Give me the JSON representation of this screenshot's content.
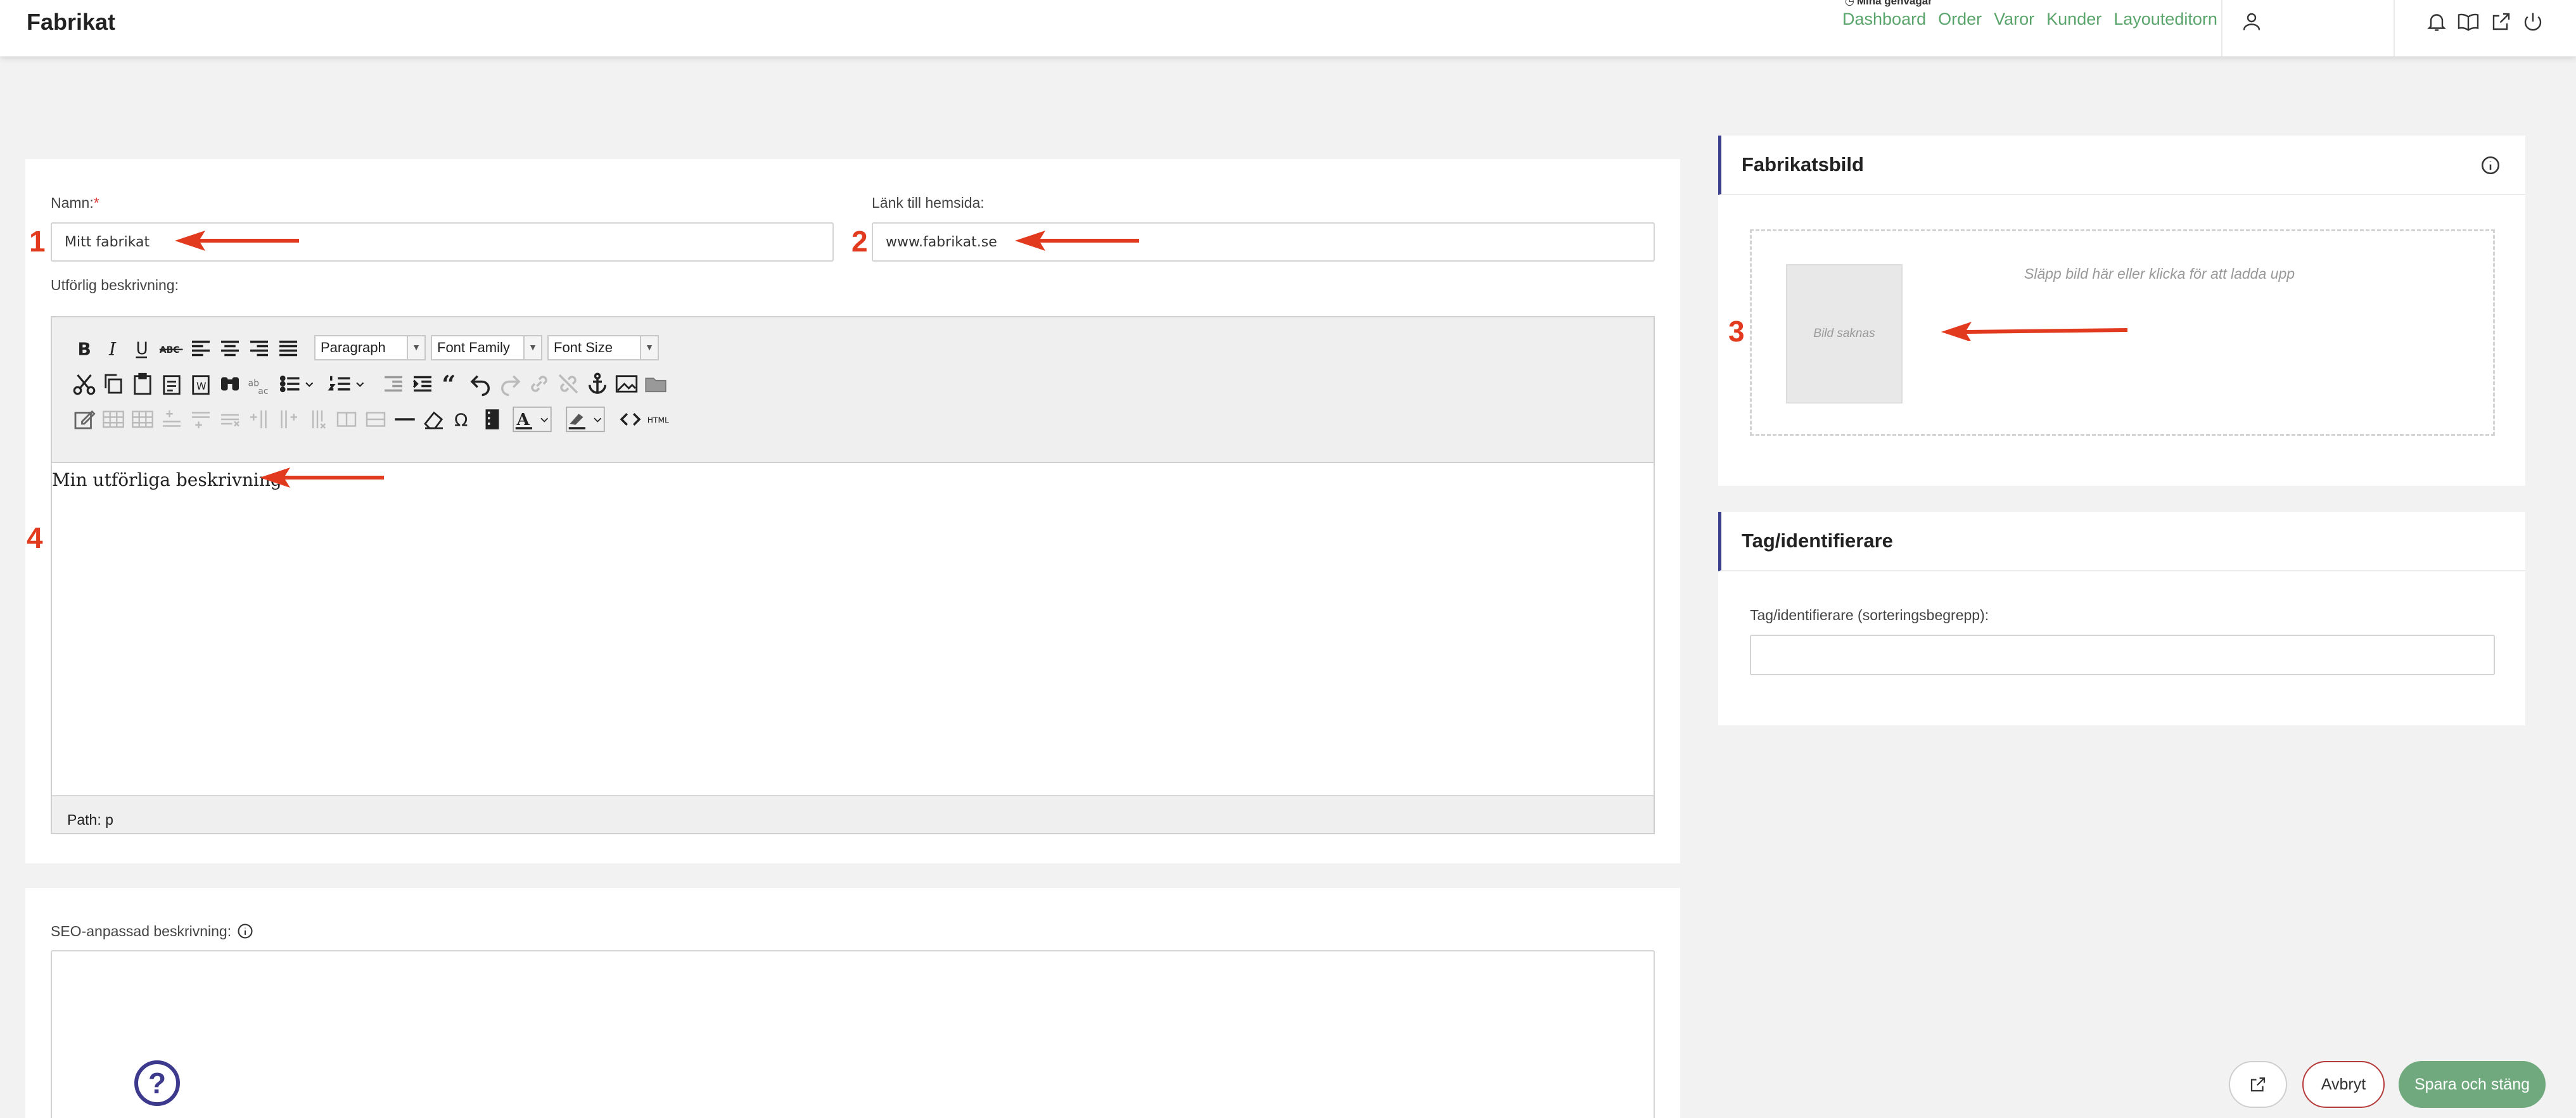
{
  "header": {
    "title": "Fabrikat",
    "shortcuts_label": "Mina genvägar",
    "nav_links": [
      "Dashboard",
      "Order",
      "Varor",
      "Kunder",
      "Layouteditorn"
    ]
  },
  "form": {
    "name_label": "Namn:",
    "name_required": "*",
    "name_value": "Mitt fabrikat",
    "link_label": "Länk till hemsida:",
    "link_value": "www.fabrikat.se",
    "description_label": "Utförlig beskrivning:",
    "editor": {
      "format_select": "Paragraph",
      "font_family_select": "Font Family",
      "font_size_select": "Font Size",
      "content": "Min utförliga beskrivning",
      "status_path": "Path: p"
    },
    "seo_label": "SEO-anpassad beskrivning:"
  },
  "image_panel": {
    "title": "Fabrikatsbild",
    "placeholder_text": "Bild saknas",
    "drop_text": "Släpp bild här eller klicka för att ladda upp"
  },
  "tag_panel": {
    "title": "Tag/identifierare",
    "field_label": "Tag/identifierare (sorteringsbegrepp):",
    "field_value": ""
  },
  "annotations": [
    "1",
    "2",
    "3",
    "4"
  ],
  "footer": {
    "help_label": "?",
    "cancel_label": "Avbryt",
    "save_label": "Spara och stäng"
  },
  "colors": {
    "accent_green": "#5aa56b",
    "save_green": "#6fa97d",
    "cancel_red": "#b53a3a",
    "annotation_red": "#e23a1e",
    "panel_accent": "#3c3f8c"
  }
}
